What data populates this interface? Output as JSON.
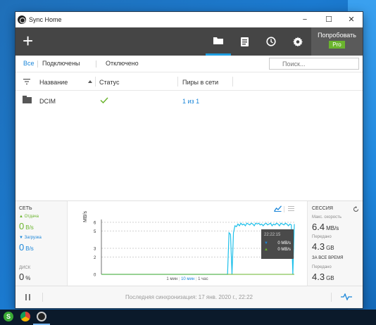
{
  "window": {
    "title": "Sync Home",
    "controls": {
      "minimize": "−",
      "maximize": "☐",
      "close": "✕"
    }
  },
  "toolbar": {
    "add_label": "+",
    "try_label": "Попробовать",
    "pro_label": "Pro",
    "active_tab": "folders"
  },
  "filters": {
    "all": "Все",
    "connected": "Подключены",
    "disconnected": "Отключено",
    "search_placeholder": "Поиск..."
  },
  "table": {
    "headers": {
      "name": "Название",
      "status": "Статус",
      "peers": "Пиры в сети"
    },
    "rows": [
      {
        "name": "DCIM",
        "status": "ok",
        "peers": "1 из 1"
      }
    ]
  },
  "network": {
    "title": "СЕТЬ",
    "upload_label": "▲ Отдача",
    "upload_value": "0",
    "upload_unit": "B/s",
    "download_label": "▼ Загрузка",
    "download_value": "0",
    "download_unit": "B/s",
    "disk_label": "ДИСК",
    "disk_value": "0",
    "disk_unit": "%"
  },
  "session": {
    "title": "СЕССИЯ",
    "max_speed_label": "Макс. скорость",
    "max_speed_value": "6.4",
    "max_speed_unit": "MB/s",
    "transferred_label": "Передано",
    "transferred_value": "4.3",
    "transferred_unit": "GB",
    "alltime_title": "ЗА ВСЕ ВРЕМЯ",
    "alltime_label": "Передано",
    "alltime_value": "4.3",
    "alltime_unit": "GB"
  },
  "chart_data": {
    "type": "line",
    "ylabel": "MB/s",
    "ylim": [
      0,
      6
    ],
    "yticks": [
      "0",
      "2",
      "3",
      "5",
      "6"
    ],
    "ranges": [
      "1 мин",
      "10 мин",
      "1 час"
    ],
    "active_range": "10 мин",
    "tooltip": {
      "time": "22:22:15",
      "down": "0 MB/s",
      "up": "0 MB/s"
    },
    "series": [
      {
        "values": [
          0,
          0,
          0,
          0,
          0,
          0,
          0,
          0,
          0,
          0,
          0,
          0,
          0,
          0,
          0,
          0,
          0,
          0,
          0,
          0,
          0,
          0,
          0,
          0,
          0,
          0,
          0,
          0,
          0,
          0,
          0,
          0,
          0,
          0,
          0,
          0,
          0,
          0,
          0,
          0,
          0,
          0,
          0,
          0,
          0,
          0,
          0,
          0,
          0,
          0,
          0,
          0,
          0,
          0,
          0,
          0,
          0,
          0,
          0,
          0,
          0,
          0,
          0,
          0,
          0,
          0,
          0,
          0,
          0,
          0,
          0,
          0,
          0,
          0,
          0,
          0,
          0,
          0,
          0,
          0,
          0,
          0,
          0,
          0,
          0,
          0,
          4.8,
          4.6,
          0,
          4.8,
          5.6,
          5.5,
          5.8,
          5.6,
          5.9,
          5.7,
          5.8,
          5.6,
          5.9,
          5.8,
          5.7,
          5.9,
          5.8,
          5.6,
          5.9,
          5.8,
          5.9,
          5.7,
          5.8,
          5.6,
          5.8,
          5.9,
          5.7,
          5.8,
          5.9,
          5.6,
          5.8,
          5.7,
          5.9,
          5.8,
          5.6,
          5.9,
          5.8,
          5.7,
          5.9,
          5.8,
          5.6,
          5.8,
          5.7,
          0,
          5.8
        ]
      },
      {
        "values": [
          0,
          0,
          0,
          0,
          0,
          0,
          0,
          0,
          0,
          0,
          0,
          0,
          0,
          0,
          0,
          0,
          0,
          0,
          0,
          0,
          0,
          0,
          0,
          0,
          0,
          0,
          0,
          0,
          0,
          0,
          0,
          0,
          0,
          0,
          0,
          0,
          0,
          0,
          0,
          0,
          0,
          0,
          0,
          0,
          0,
          0,
          0,
          0,
          0,
          0,
          0,
          0,
          0,
          0,
          0,
          0,
          0,
          0,
          0,
          0,
          0,
          0,
          0,
          0,
          0,
          0,
          0,
          0,
          0,
          0,
          0,
          0,
          0,
          0,
          0,
          0,
          0,
          0,
          0,
          0,
          0,
          0,
          0,
          0,
          0,
          0,
          0,
          0,
          0,
          0,
          0,
          0,
          0,
          0,
          0,
          0,
          0,
          0,
          0,
          0,
          0,
          0,
          0,
          0,
          0,
          0,
          0,
          0,
          0,
          0,
          0,
          0,
          0,
          0,
          0,
          0,
          0,
          0,
          0,
          0,
          0,
          0,
          0,
          0,
          0,
          0,
          0,
          0,
          0,
          0,
          0,
          0,
          0,
          0,
          0,
          0
        ]
      }
    ]
  },
  "statusbar": {
    "pause_icon": "pause-icon",
    "text": "Последняя синхронизация: 17 янв. 2020 г., 22:22"
  },
  "colors": {
    "accent": "#1a86d9",
    "pro": "#6ab42d",
    "toolbar": "#454545"
  }
}
